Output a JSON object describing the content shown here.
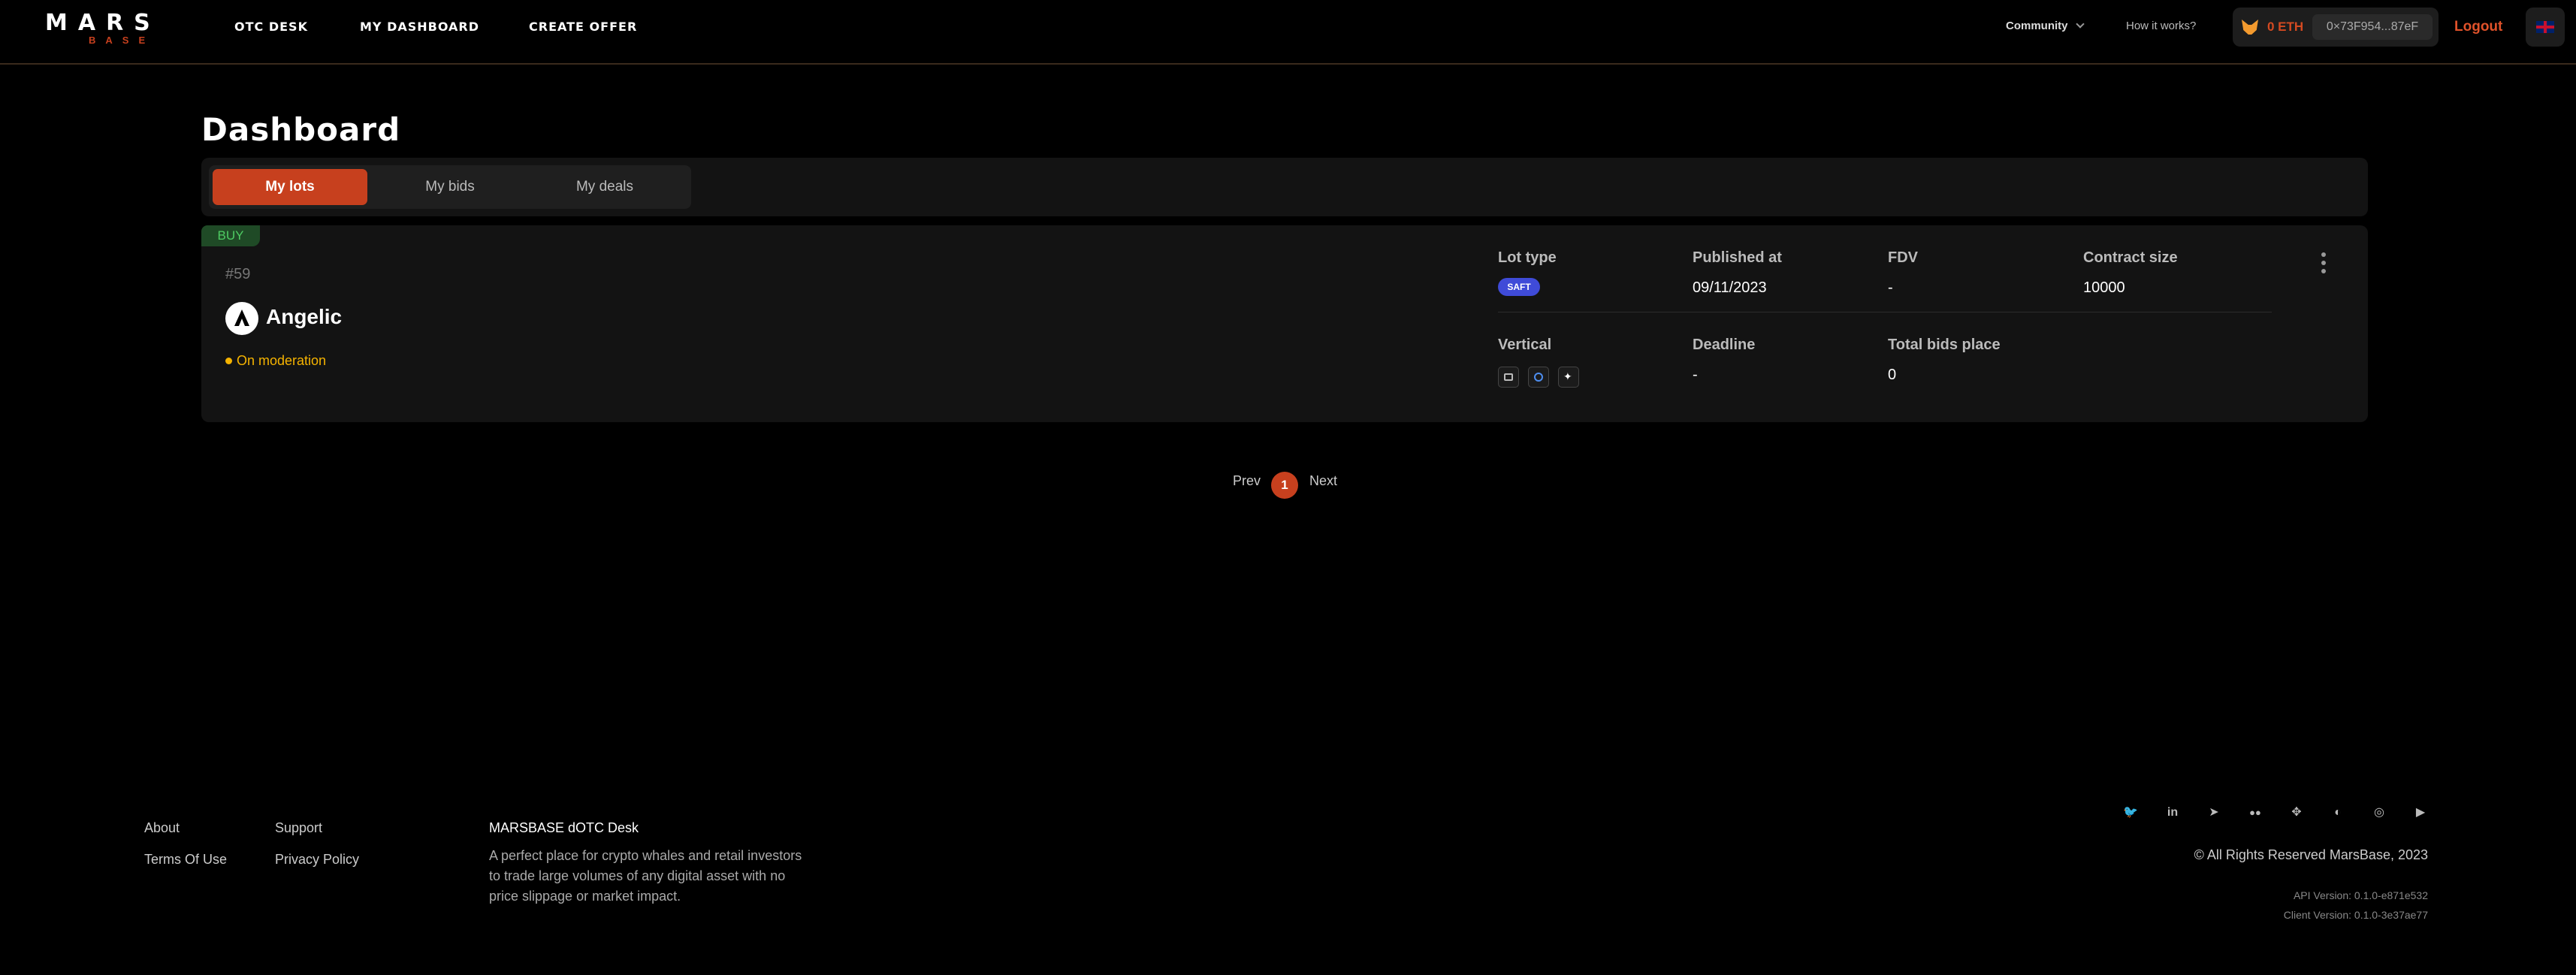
{
  "header": {
    "logo_top": "MARS",
    "logo_bottom": "BASE",
    "nav": [
      "OTC DESK",
      "MY DASHBOARD",
      "CREATE OFFER"
    ],
    "community": "Community",
    "how_it_works": "How it works?",
    "wallet_balance": "0 ETH",
    "wallet_address": "0×73F954...87eF",
    "logout": "Logout",
    "language_icon": "uk-flag-icon"
  },
  "page_title": "Dashboard",
  "tabs": [
    {
      "label": "My lots",
      "active": true
    },
    {
      "label": "My bids",
      "active": false
    },
    {
      "label": "My deals",
      "active": false
    }
  ],
  "lot": {
    "side": "BUY",
    "number": "#59",
    "token": "Angelic",
    "status": "On moderation",
    "lot_type_label": "Lot type",
    "lot_type": "SAFT",
    "published_label": "Published at",
    "published": "09/11/2023",
    "fdv_label": "FDV",
    "fdv": "-",
    "contract_size_label": "Contract size",
    "contract_size": "10000",
    "vertical_label": "Vertical",
    "vertical_icons": [
      "card-icon",
      "globe-icon",
      "star-icon"
    ],
    "deadline_label": "Deadline",
    "deadline": "-",
    "total_bids_label": "Total bids place",
    "total_bids": "0"
  },
  "pagination": {
    "prev": "Prev",
    "current": "1",
    "next": "Next"
  },
  "footer": {
    "about": "About",
    "support": "Support",
    "terms": "Terms Of Use",
    "privacy": "Privacy Policy",
    "title": "MARSBASE dOTC Desk",
    "description": "A perfect place for crypto whales and retail investors to trade large volumes of any digital asset with no price slippage or market impact.",
    "social_icons": [
      "twitter-icon",
      "linkedin-icon",
      "telegram-icon",
      "medium-icon",
      "coinmarketcap-icon",
      "github-icon",
      "instagram-icon",
      "youtube-icon"
    ],
    "copyright": "© All Rights Reserved MarsBase, 2023",
    "api_version": "API Version: 0.1.0-e871e532",
    "client_version": "Client Version: 0.1.0-3e37ae77"
  },
  "colors": {
    "accent": "#c7401e",
    "status": "#f5b300",
    "saft": "#3f4bd8",
    "buy": "#4ecb62"
  }
}
